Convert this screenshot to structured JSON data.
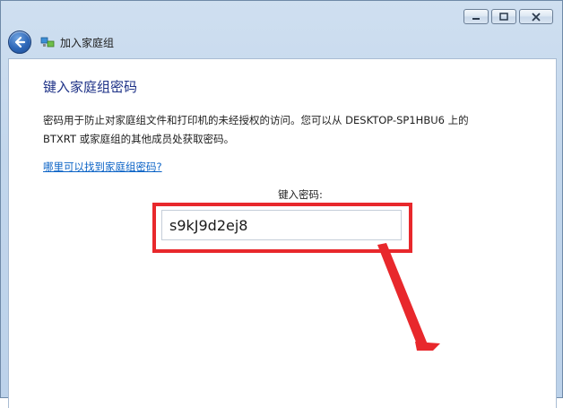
{
  "window": {
    "title": "加入家庭组"
  },
  "page": {
    "heading": "键入家庭组密码",
    "description_line1": "密码用于防止对家庭组文件和打印机的未经授权的访问。您可以从 DESKTOP-SP1HBU6 上的",
    "description_line2": "BTXRT 或家庭组的其他成员处获取密码。",
    "help_link": "哪里可以找到家庭组密码?",
    "password_label": "键入密码:",
    "password_value": "s9kJ9d2ej8"
  },
  "icons": {
    "back": "back-arrow-icon",
    "app": "homegroup-icon",
    "minimize": "minimize-icon",
    "maximize": "maximize-icon",
    "close": "close-icon"
  },
  "colors": {
    "heading": "#1e3287",
    "link": "#0b63c6",
    "highlight": "#e8282c"
  }
}
